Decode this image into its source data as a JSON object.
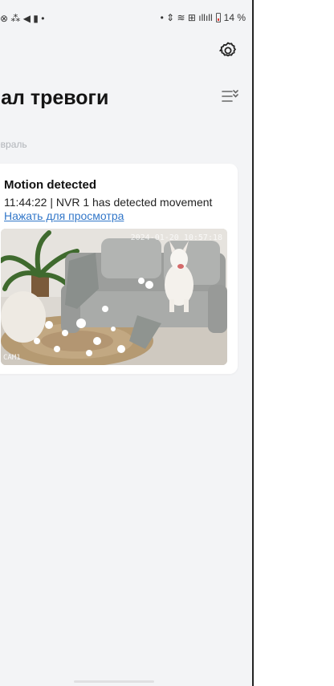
{
  "status_bar": {
    "left_icons": [
      "whatsapp-icon",
      "dots-icon",
      "send-icon",
      "battery-saver-icon",
      "dot"
    ],
    "left_glyphs": "⊗ ⁂ ◀ ▮ •",
    "right_glyphs": "• ⇕ ≋ ⊞ ıllıll",
    "battery": "14 %"
  },
  "header": {
    "title": "нал тревоги",
    "settings_icon": "gear-icon",
    "filter_icon": "filter-list-icon"
  },
  "month": "евраль",
  "event": {
    "title": "Motion detected",
    "description": "11:44:22 | NVR 1 has detected movement",
    "link": "Нажать для просмотра",
    "osd_time": "2024-01-20  10:57:18",
    "osd_camera": "CAM1"
  },
  "colors": {
    "background": "#f3f4f6",
    "card": "#ffffff",
    "link": "#3277c9",
    "sofa": "#a9aba9"
  }
}
